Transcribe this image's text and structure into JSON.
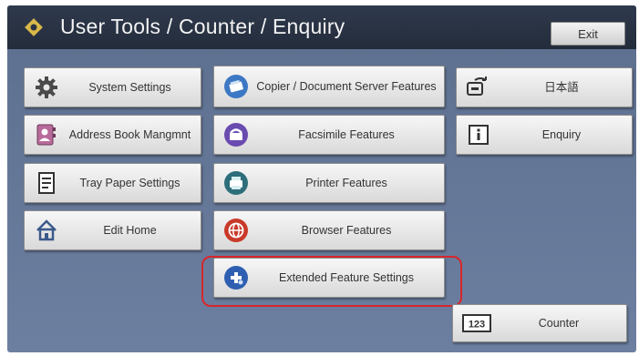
{
  "header": {
    "title": "User Tools / Counter / Enquiry",
    "exit_label": "Exit"
  },
  "left_column": [
    {
      "label": "System Settings",
      "icon": "gear-icon"
    },
    {
      "label": "Address Book Mangmnt",
      "icon": "address-book-icon"
    },
    {
      "label": "Tray Paper Settings",
      "icon": "tray-paper-icon"
    },
    {
      "label": "Edit Home",
      "icon": "home-icon"
    }
  ],
  "middle_column": [
    {
      "label": "Copier / Document Server Features",
      "icon": "copier-icon"
    },
    {
      "label": "Facsimile Features",
      "icon": "fax-icon"
    },
    {
      "label": "Printer Features",
      "icon": "printer-icon"
    },
    {
      "label": "Browser Features",
      "icon": "browser-icon"
    },
    {
      "label": "Extended Feature Settings",
      "icon": "extended-feature-icon",
      "highlighted": true
    }
  ],
  "right_column": [
    {
      "label": "日本語",
      "icon": "language-switch-icon"
    },
    {
      "label": "Enquiry",
      "icon": "info-icon"
    }
  ],
  "counter": {
    "label": "Counter",
    "icon_text": "123"
  },
  "colors": {
    "highlight": "#d8262b",
    "screen_bg": "#5d6f8e",
    "titlebar": "#2a3345"
  }
}
